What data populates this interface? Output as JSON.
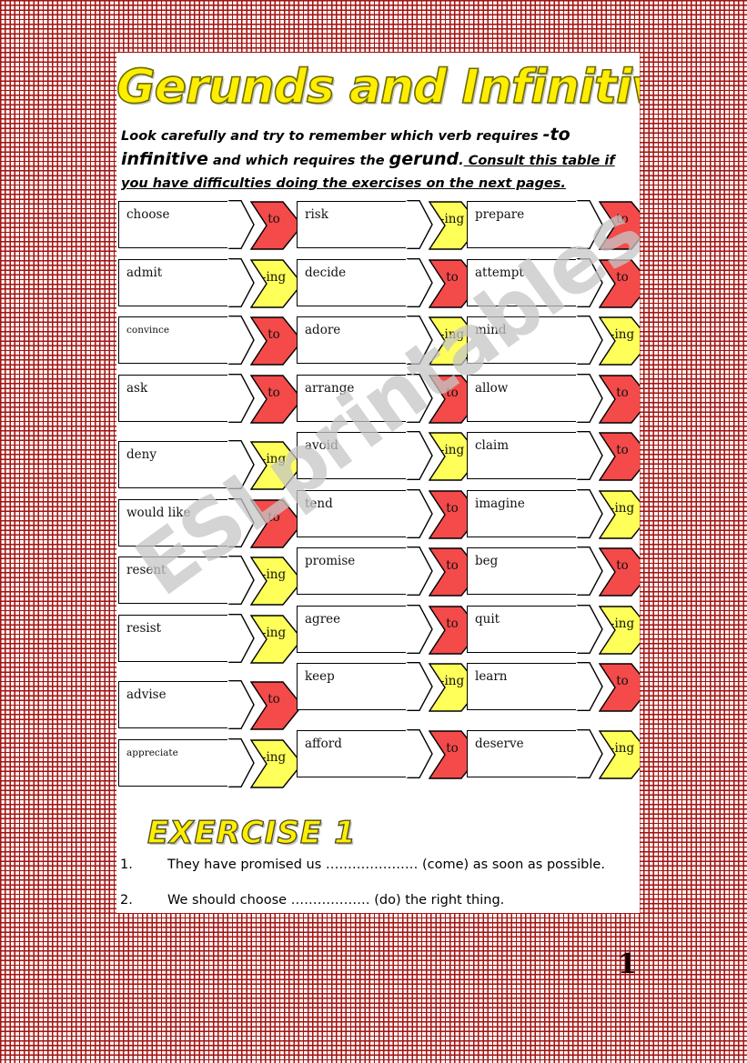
{
  "worksheet": {
    "title": "Gerunds and Infinitives",
    "page_number": "1",
    "watermark": "ESLprintables.com",
    "intro": {
      "line1_a": "Look carefully and try to remember which verb requires ",
      "line1_b": "-to",
      "line2_a": "infinitive",
      "line2_b": " and which requires the ",
      "line2_c": "gerund",
      "line2_d": ".",
      "line2_e": "  Consult this table if",
      "line3": "you have difficulties doing the exercises on the next pages."
    }
  },
  "colors": {
    "red": "#f44a4a",
    "yellow": "#ffff5a",
    "outline": "#000000",
    "title_yellow": "#ffee00",
    "background_grid": "#a01414",
    "page_white": "#ffffff"
  },
  "table": {
    "columns": [
      {
        "name": "column-1",
        "rows": [
          {
            "verb": "choose",
            "form": "to",
            "type": "infinitive",
            "gap": false
          },
          {
            "verb": "admit",
            "form": "-ing",
            "type": "gerund",
            "gap": false
          },
          {
            "verb": "convince",
            "form": "to",
            "type": "infinitive",
            "gap": false,
            "small": true
          },
          {
            "verb": "ask",
            "form": "to",
            "type": "infinitive",
            "gap": false
          },
          {
            "verb": "deny",
            "form": "-ing",
            "type": "gerund",
            "gap": true
          },
          {
            "verb": "would like",
            "form": "to",
            "type": "infinitive",
            "gap": false
          },
          {
            "verb": "resent",
            "form": "-ing",
            "type": "gerund",
            "gap": false
          },
          {
            "verb": "resist",
            "form": "-ing",
            "type": "gerund",
            "gap": false
          },
          {
            "verb": "advise",
            "form": "to",
            "type": "infinitive",
            "gap": true
          },
          {
            "verb": "appreciate",
            "form": "-ing",
            "type": "gerund",
            "gap": false,
            "small": true
          }
        ]
      },
      {
        "name": "column-2",
        "rows": [
          {
            "verb": "risk",
            "form": "-ing",
            "type": "gerund",
            "gap": false
          },
          {
            "verb": "decide",
            "form": "to",
            "type": "infinitive",
            "gap": false
          },
          {
            "verb": "adore",
            "form": "-ing",
            "type": "gerund",
            "gap": false
          },
          {
            "verb": "arrange",
            "form": "to",
            "type": "infinitive",
            "gap": false
          },
          {
            "verb": "avoid",
            "form": "-ing",
            "type": "gerund",
            "gap": false
          },
          {
            "verb": "tend",
            "form": "to",
            "type": "infinitive",
            "gap": false
          },
          {
            "verb": "promise",
            "form": "to",
            "type": "infinitive",
            "gap": false
          },
          {
            "verb": "agree",
            "form": "to",
            "type": "infinitive",
            "gap": false
          },
          {
            "verb": "keep",
            "form": "-ing",
            "type": "gerund",
            "gap": false
          },
          {
            "verb": "afford",
            "form": "to",
            "type": "infinitive",
            "gap": true
          }
        ]
      },
      {
        "name": "column-3",
        "rows": [
          {
            "verb": "prepare",
            "form": "to",
            "type": "infinitive",
            "gap": false
          },
          {
            "verb": "attempt",
            "form": "to",
            "type": "infinitive",
            "gap": false
          },
          {
            "verb": "mind",
            "form": "-ing",
            "type": "gerund",
            "gap": false
          },
          {
            "verb": "allow",
            "form": "to",
            "type": "infinitive",
            "gap": false
          },
          {
            "verb": "claim",
            "form": "to",
            "type": "infinitive",
            "gap": false
          },
          {
            "verb": "imagine",
            "form": "-ing",
            "type": "gerund",
            "gap": false
          },
          {
            "verb": "beg",
            "form": "to",
            "type": "infinitive",
            "gap": false
          },
          {
            "verb": "quit",
            "form": "-ing",
            "type": "gerund",
            "gap": false
          },
          {
            "verb": "learn",
            "form": "to",
            "type": "infinitive",
            "gap": false
          },
          {
            "verb": "deserve",
            "form": "-ing",
            "type": "gerund",
            "gap": true
          }
        ]
      }
    ]
  },
  "exercise": {
    "heading": "EXERCISE 1",
    "items": [
      {
        "number": "1.",
        "text": "They have promised us ………………… (come) as soon as possible."
      },
      {
        "number": "2.",
        "text": "We should choose ……………… (do) the right thing."
      }
    ]
  }
}
